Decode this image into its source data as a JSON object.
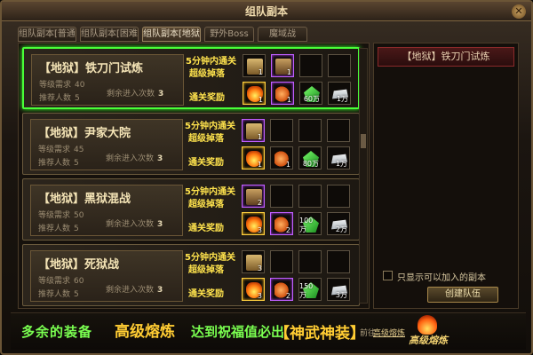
{
  "window": {
    "title": "组队副本"
  },
  "tabs": [
    {
      "label": "组队副本[普通]",
      "active": false
    },
    {
      "label": "组队副本[困难]",
      "active": false
    },
    {
      "label": "组队副本[地狱]",
      "active": true
    },
    {
      "label": "野外Boss",
      "active": false
    },
    {
      "label": "魔域战",
      "active": false
    }
  ],
  "dungeons": [
    {
      "name": "【地狱】铁刀门试炼",
      "level_label": "等级需求",
      "level": "40",
      "rec_label": "推荐人数",
      "rec": "5",
      "remain_label": "剩余进入次数",
      "remain": "3",
      "time_label": "5分钟内通关",
      "drop_label": "超级掉落",
      "reward_label": "通关奖励",
      "drop_qty": "1",
      "drop2_qty": "1",
      "r1": "1",
      "r2": "1",
      "r3": "60万",
      "r4": "1万",
      "selected": true
    },
    {
      "name": "【地狱】尹家大院",
      "level_label": "等级需求",
      "level": "45",
      "rec_label": "推荐人数",
      "rec": "5",
      "remain_label": "剩余进入次数",
      "remain": "3",
      "time_label": "5分钟内通关",
      "drop_label": "超级掉落",
      "reward_label": "通关奖励",
      "drop_qty": "1",
      "r1": "1",
      "r2": "1",
      "r3": "80万",
      "r4": "1万",
      "selected": false
    },
    {
      "name": "【地狱】黑狱混战",
      "level_label": "等级需求",
      "level": "50",
      "rec_label": "推荐人数",
      "rec": "5",
      "remain_label": "剩余进入次数",
      "remain": "3",
      "time_label": "5分钟内通关",
      "drop_label": "超级掉落",
      "reward_label": "通关奖励",
      "drop_qty": "2",
      "r1": "3",
      "r2": "2",
      "r3": "100万",
      "r4": "2万",
      "selected": false
    },
    {
      "name": "【地狱】死狱战",
      "level_label": "等级需求",
      "level": "60",
      "rec_label": "推荐人数",
      "rec": "5",
      "remain_label": "剩余进入次数",
      "remain": "3",
      "time_label": "5分钟内通关",
      "drop_label": "超级掉落",
      "reward_label": "通关奖励",
      "drop_qty": "3",
      "r1": "3",
      "r2": "2",
      "r3": "150万",
      "r4": "3万",
      "selected": false
    }
  ],
  "right_panel": {
    "title": "【地狱】铁刀门试炼",
    "checkbox_label": "只显示可以加入的副本",
    "create_button": "创建队伍"
  },
  "banner": {
    "part1": "多余的装备",
    "part2": "高级熔炼",
    "part3": "达到祝福值必出",
    "part4": "【神武神装】",
    "goto": "前往",
    "link": "高级熔炼",
    "logo": "高级熔炼"
  },
  "colors": {
    "accent_green": "#49ff38",
    "gold": "#ffcc33",
    "purple_border": "#c060ff"
  },
  "icons": [
    "close-icon",
    "chest-icon",
    "fire-orb-icon",
    "wing-icon",
    "green-gem-icon",
    "silver-ingot-icon",
    "flame-logo-icon"
  ]
}
